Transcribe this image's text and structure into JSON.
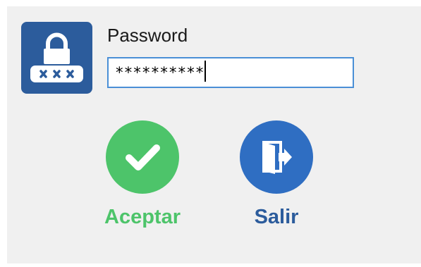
{
  "dialog": {
    "password_label": "Password",
    "password_value": "**********",
    "accept_label": "Aceptar",
    "exit_label": "Salir"
  },
  "icons": {
    "lock": "lock-password-icon",
    "accept": "checkmark-icon",
    "exit": "exit-door-icon"
  },
  "colors": {
    "tile_blue": "#2c5c9c",
    "accept_green": "#4dc46a",
    "exit_blue": "#2f6ec2",
    "input_border": "#4a8fd6",
    "background": "#f0f0f0"
  }
}
